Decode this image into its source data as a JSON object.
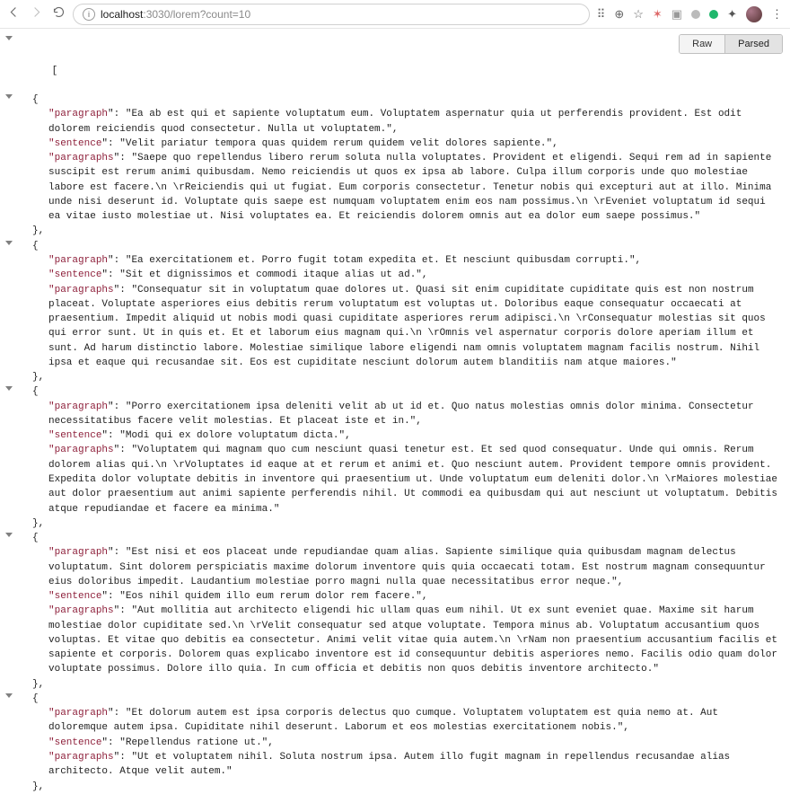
{
  "browser": {
    "url_host": "localhost",
    "url_port_path": ":3030/lorem?count=10",
    "toggle_raw": "Raw",
    "toggle_parsed": "Parsed"
  },
  "json_open_bracket": "[",
  "entries": [
    {
      "paragraph": "Ea ab est qui et sapiente voluptatum eum. Voluptatem aspernatur quia ut perferendis provident. Est odit dolorem reiciendis quod consectetur. Nulla ut voluptatem.",
      "sentence": "Velit pariatur tempora quas quidem rerum quidem velit dolores sapiente.",
      "paragraphs": "Saepe quo repellendus libero rerum soluta nulla voluptates. Provident et eligendi. Sequi rem ad in sapiente suscipit est rerum animi quibusdam. Nemo reiciendis ut quos ex ipsa ab labore. Culpa illum corporis unde quo molestiae labore est facere.\\n \\rReiciendis qui ut fugiat. Eum corporis consectetur. Tenetur nobis qui excepturi aut at illo. Minima unde nisi deserunt id. Voluptate quis saepe est numquam voluptatem enim eos nam possimus.\\n \\rEveniet voluptatum id sequi ea vitae iusto molestiae ut. Nisi voluptates ea. Et reiciendis dolorem omnis aut ea dolor eum saepe possimus."
    },
    {
      "paragraph": "Ea exercitationem et. Porro fugit totam expedita et. Et nesciunt quibusdam corrupti.",
      "sentence": "Sit et dignissimos et commodi itaque alias ut ad.",
      "paragraphs": "Consequatur sit in voluptatum quae dolores ut. Quasi sit enim cupiditate cupiditate quis est non nostrum placeat. Voluptate asperiores eius debitis rerum voluptatum est voluptas ut. Doloribus eaque consequatur occaecati at praesentium. Impedit aliquid ut nobis modi quasi cupiditate asperiores rerum adipisci.\\n \\rConsequatur molestias sit quos qui error sunt. Ut in quis et. Et et laborum eius magnam qui.\\n \\rOmnis vel aspernatur corporis dolore aperiam illum et sunt. Ad harum distinctio labore. Molestiae similique labore eligendi nam omnis voluptatem magnam facilis nostrum. Nihil ipsa et eaque qui recusandae sit. Eos est cupiditate nesciunt dolorum autem blanditiis nam atque maiores."
    },
    {
      "paragraph": "Porro exercitationem ipsa deleniti velit ab ut id et. Quo natus molestias omnis dolor minima. Consectetur necessitatibus facere velit molestias. Et placeat iste et in.",
      "sentence": "Modi qui ex dolore voluptatum dicta.",
      "paragraphs": "Voluptatem qui magnam quo cum nesciunt quasi tenetur est. Et sed quod consequatur. Unde qui omnis. Rerum dolorem alias qui.\\n \\rVoluptates id eaque at et rerum et animi et. Quo nesciunt autem. Provident tempore omnis provident. Expedita dolor voluptate debitis in inventore qui praesentium ut. Unde voluptatum eum deleniti dolor.\\n \\rMaiores molestiae aut dolor praesentium aut animi sapiente perferendis nihil. Ut commodi ea quibusdam qui aut nesciunt ut voluptatum. Debitis atque repudiandae et facere ea minima."
    },
    {
      "paragraph": "Est nisi et eos placeat unde repudiandae quam alias. Sapiente similique quia quibusdam magnam delectus voluptatum. Sint dolorem perspiciatis maxime dolorum inventore quis quia occaecati totam. Est nostrum magnam consequuntur eius doloribus impedit. Laudantium molestiae porro magni nulla quae necessitatibus error neque.",
      "sentence": "Eos nihil quidem illo eum rerum dolor rem facere.",
      "paragraphs": "Aut mollitia aut architecto eligendi hic ullam quas eum nihil. Ut ex sunt eveniet quae. Maxime sit harum molestiae dolor cupiditate sed.\\n \\rVelit consequatur sed atque voluptate. Tempora minus ab. Voluptatum accusantium quos voluptas. Et vitae quo debitis ea consectetur. Animi velit vitae quia autem.\\n \\rNam non praesentium accusantium facilis et sapiente et corporis. Dolorem quas explicabo inventore est id consequuntur debitis asperiores nemo. Facilis odio quam dolor voluptate possimus. Dolore illo quia. In cum officia et debitis non quos debitis inventore architecto."
    },
    {
      "paragraph": "Et dolorum autem est ipsa corporis delectus quo cumque. Voluptatem voluptatem est quia nemo at. Aut doloremque autem ipsa. Cupiditate nihil deserunt. Laborum et eos molestias exercitationem nobis.",
      "sentence": "Repellendus ratione ut.",
      "paragraphs": "Ut et voluptatem nihil. Soluta nostrum ipsa. Autem illo fugit magnam in repellendus recusandae alias architecto. Atque velit autem."
    }
  ]
}
